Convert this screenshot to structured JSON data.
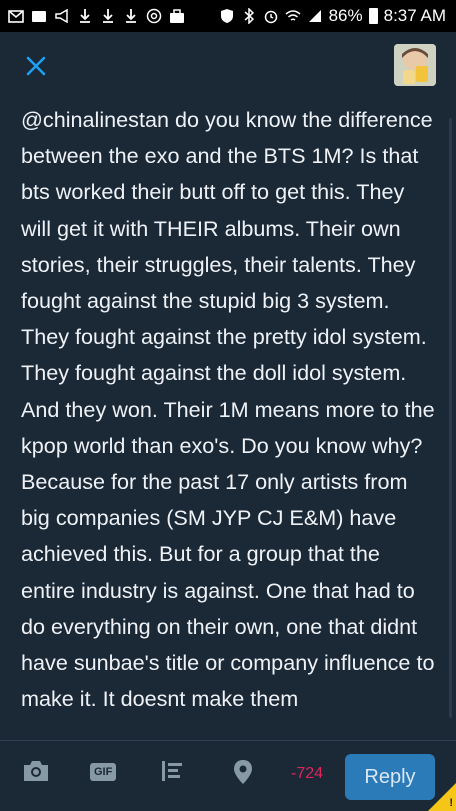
{
  "status_bar": {
    "battery": "86%",
    "time": "8:37 AM",
    "icons": [
      "mail-icon",
      "cast-icon",
      "megaphone-icon",
      "download-icon",
      "download-icon",
      "download-icon",
      "at-icon",
      "briefcase-icon",
      "shield-icon",
      "bluetooth-icon",
      "alarm-icon",
      "wifi-icon",
      "signal-icon",
      "battery-icon"
    ]
  },
  "header": {
    "close_icon": "close-icon",
    "avatar_icon": "profile-avatar"
  },
  "compose": {
    "text": "@chinalinestan do you know the difference between the exo and the BTS 1M? Is that bts worked their butt off to get this. They will get it with THEIR albums. Their own stories, their struggles, their talents. They fought against the stupid big 3 system. They fought against the pretty idol system. They fought against the doll idol system. And they won. Their 1M means more to the kpop world than exo's. Do you know why? Because for the past 17 only artists from big companies (SM JYP CJ E&M) have achieved this. But for a group that the entire industry is against. One that had to do everything on their own, one that didnt have sunbae's title or company influence to make it. It doesnt make them"
  },
  "toolbar": {
    "gif_label": "GIF",
    "counter": "-724",
    "reply_label": "Reply"
  },
  "colors": {
    "accent": "#1da1f2",
    "background": "#1b2836",
    "counter_negative": "#e0245e",
    "reply_button": "#2b7bb9"
  }
}
